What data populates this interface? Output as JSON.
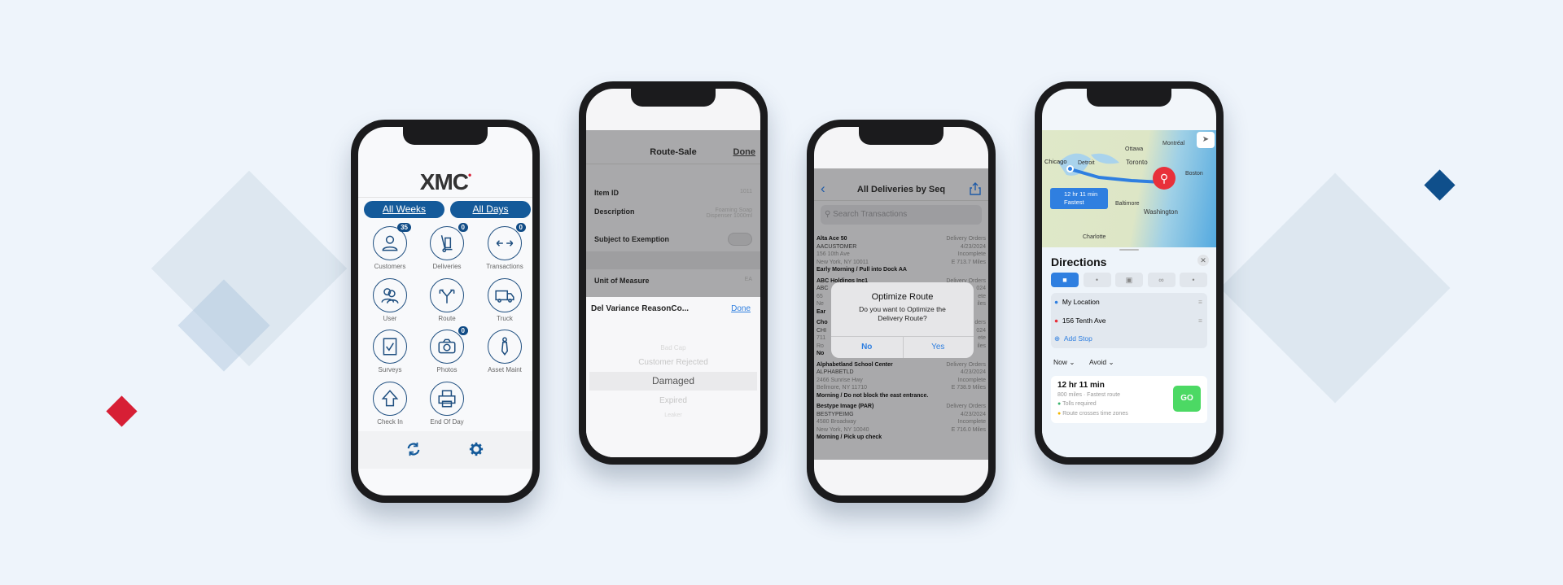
{
  "colors": {
    "brand_blue": "#145a9a",
    "accent_red": "#d71f35",
    "ios_blue": "#2f7fe0",
    "go_green": "#4cd964"
  },
  "phone1": {
    "logo": "XMC",
    "buttons": [
      "All Weeks",
      "All Days"
    ],
    "tiles": [
      {
        "label": "Customers",
        "icon": "person-icon",
        "badge": "35"
      },
      {
        "label": "Deliveries",
        "icon": "hand-truck-icon",
        "badge": "0"
      },
      {
        "label": "Transactions",
        "icon": "arrows-left-right-icon",
        "badge": "0"
      },
      {
        "label": "User",
        "icon": "users-icon",
        "badge": null
      },
      {
        "label": "Route",
        "icon": "route-fork-icon",
        "badge": null
      },
      {
        "label": "Truck",
        "icon": "truck-icon",
        "badge": null
      },
      {
        "label": "Surveys",
        "icon": "checkbox-icon",
        "badge": null
      },
      {
        "label": "Photos",
        "icon": "camera-icon",
        "badge": "0"
      },
      {
        "label": "Asset Maint",
        "icon": "asset-icon",
        "badge": null
      },
      {
        "label": "Check In",
        "icon": "arrow-up-icon",
        "badge": null
      },
      {
        "label": "End Of Day",
        "icon": "printer-icon",
        "badge": null
      }
    ],
    "toolbar": {
      "sync_icon": "sync-icon",
      "settings_icon": "gear-icon"
    }
  },
  "phone2": {
    "title": "Route-Sale",
    "done": "Done",
    "fields": [
      {
        "label": "Item ID",
        "value": "1011"
      },
      {
        "label": "Description",
        "value": "Foaming Soap",
        "value2": "Dispenser 1000ml"
      },
      {
        "label": "Subject to Exemption",
        "toggle": false
      },
      {
        "label": "Unit of Measure",
        "value": "EA"
      }
    ],
    "sheet": {
      "title": "Del Variance ReasonCo...",
      "done": "Done",
      "options": [
        "Bad Cap",
        "Customer Rejected",
        "Damaged",
        "Expired",
        "Leaker"
      ],
      "selected": "Damaged"
    }
  },
  "phone3": {
    "title": "All Deliveries by Seq",
    "search_placeholder": "Search Transactions",
    "rows": [
      {
        "name": "Alta Ace 50",
        "code": "AACUSTOMER",
        "addr1": "156 10th Ave",
        "addr2": "New York, NY  10011",
        "note": "Early Morning / Pull into Dock AA",
        "type": "Delivery Orders",
        "date": "4/23/2024",
        "status": "Incomplete",
        "dist": "E 713.7 Miles"
      },
      {
        "name": "ABC Holdings Inc1",
        "code": "ABC",
        "addr1": "65",
        "addr2": "Ne",
        "note": "Ear",
        "type": "Delivery Orders",
        "date": "024",
        "status": "ete",
        "dist": "iles"
      },
      {
        "name": "Cho",
        "code": "CHI",
        "addr1": "711",
        "addr2": "Ro",
        "note": "No",
        "type": "ders",
        "date": "024",
        "status": "ete",
        "dist": "iles"
      },
      {
        "name": "Alphabetland School Center",
        "code": "ALPHABETLD",
        "addr1": "2466 Sunrise Hwy",
        "addr2": "Bellmore, NY  11710",
        "note": "Morning / Do not block the east entrance.",
        "type": "Delivery Orders",
        "date": "4/23/2024",
        "status": "Incomplete",
        "dist": "E 738.9 Miles"
      },
      {
        "name": "Bestype Image (PAR)",
        "code": "BESTYPEIMG",
        "addr1": "4580 Broadway",
        "addr2": "New York, NY  10040",
        "note": "Morning / Pick up check",
        "type": "Delivery Orders",
        "date": "4/23/2024",
        "status": "Incomplete",
        "dist": "E 716.0 Miles"
      }
    ],
    "dialog": {
      "title": "Optimize Route",
      "message": "Do you want to Optimize the Delivery Route?",
      "no": "No",
      "yes": "Yes"
    }
  },
  "phone4": {
    "map_labels": [
      "Ottawa",
      "Montréal",
      "Toronto",
      "Detroit",
      "Chicago",
      "Boston",
      "Baltimore",
      "Washington",
      "Charlotte"
    ],
    "route_callout": {
      "time": "12 hr 11 min",
      "tag": "Fastest"
    },
    "title": "Directions",
    "modes": [
      "car-icon",
      "walk-icon",
      "transit-icon",
      "bike-icon",
      "rideshare-icon"
    ],
    "stops": [
      "My Location",
      "156 Tenth Ave",
      "Add Stop"
    ],
    "options": [
      "Now",
      "Avoid"
    ],
    "result": {
      "time": "12 hr 11 min",
      "summary": "800 miles · Fastest route",
      "notes": [
        "Tolls required",
        "Route crosses time zones"
      ],
      "go": "GO"
    }
  }
}
